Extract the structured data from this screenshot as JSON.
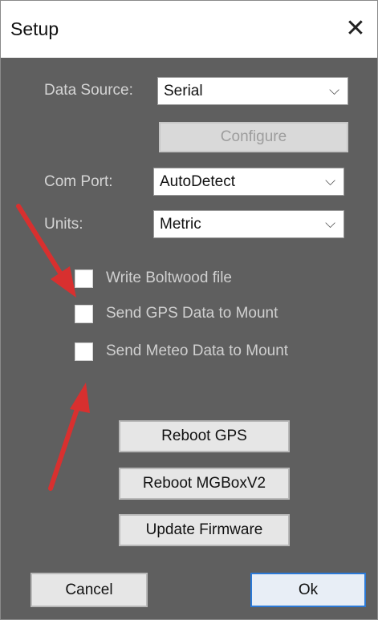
{
  "window": {
    "title": "Setup"
  },
  "form": {
    "data_source": {
      "label": "Data Source:",
      "value": "Serial"
    },
    "configure_label": "Configure",
    "com_port": {
      "label": "Com Port:",
      "value": "AutoDetect"
    },
    "units": {
      "label": "Units:",
      "value": "Metric"
    }
  },
  "checkboxes": [
    {
      "label": "Write Boltwood file",
      "checked": false
    },
    {
      "label": "Send GPS Data to Mount",
      "checked": false
    },
    {
      "label": "Send Meteo Data to Mount",
      "checked": false
    }
  ],
  "buttons": {
    "reboot_gps": "Reboot GPS",
    "reboot_mgbox": "Reboot MGBoxV2",
    "update_firmware": "Update Firmware",
    "cancel": "Cancel",
    "ok": "Ok"
  },
  "colors": {
    "annotation_arrow": "#d8302f",
    "ok_border": "#2b79d6",
    "dialog_background": "#5f5f5f"
  }
}
